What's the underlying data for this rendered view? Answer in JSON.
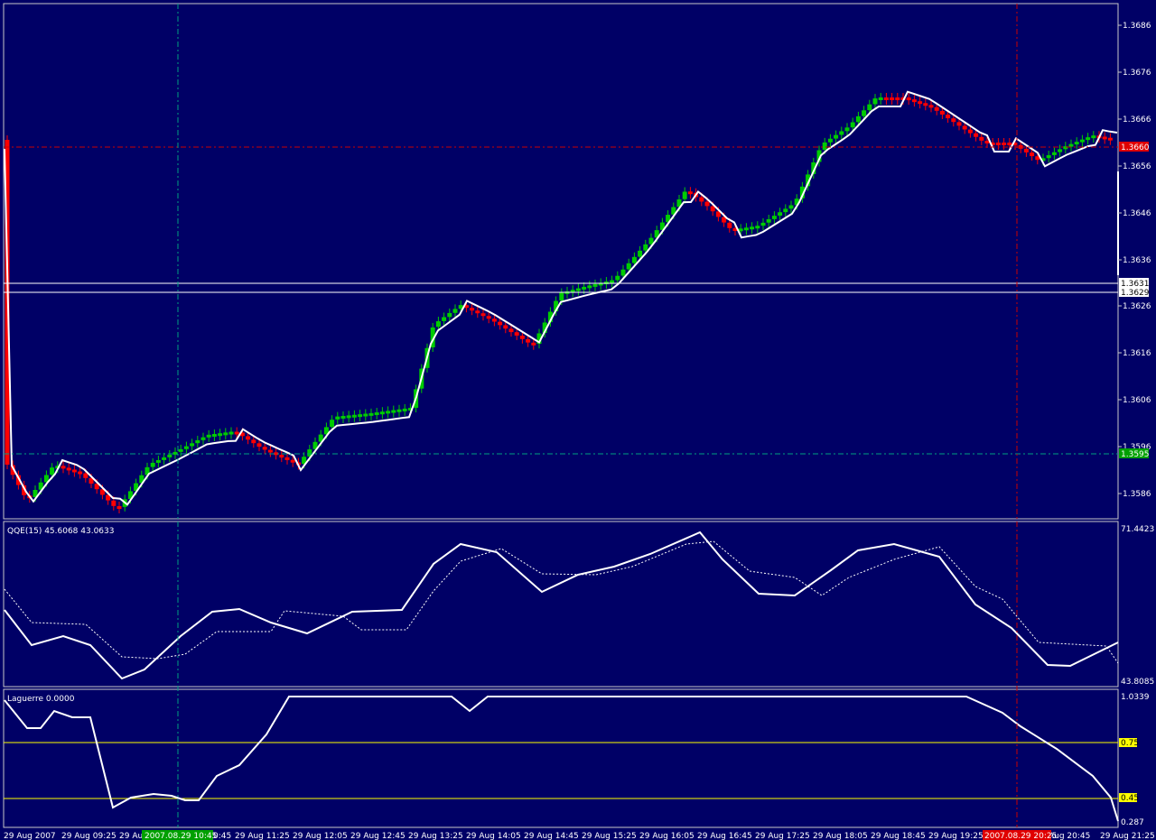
{
  "colors": {
    "background": "#000066",
    "frame": "#c8c8c8",
    "bull": "#00cc00",
    "bear": "#ff0000",
    "line": "#ffffff",
    "level": "#ffff00",
    "vline_green": "#00a080",
    "vline_red": "#cc0000",
    "hline_red": "#cc0000",
    "hline_green": "#00a080",
    "label_red_bg": "#e00000",
    "label_green_bg": "#00a000"
  },
  "price_panel": {
    "ticks": [
      "1.3686",
      "1.3676",
      "1.3666",
      "1.3656",
      "1.3646",
      "1.3636",
      "1.3626",
      "1.3616",
      "1.3606",
      "1.3596",
      "1.3586"
    ],
    "red_level": "1.3660",
    "green_level": "1.3595",
    "band_upper": "1.3631",
    "band_lower": "1.3629"
  },
  "qqe_panel": {
    "title": "QQE(15) 45.6068 43.0633",
    "top": "71.4423",
    "bottom": "43.8085"
  },
  "laguerre_panel": {
    "title": "Laguerre 0.0000",
    "top": "1.0339",
    "level_75": "0.75",
    "level_45": "0.45",
    "bottom": "0.287"
  },
  "time_axis": {
    "labels": [
      "29 Aug 2007",
      "29 Aug 09:25",
      "29 Au",
      "0:45",
      "29 Aug 11:25",
      "29 Aug 12:05",
      "29 Aug 12:45",
      "29 Aug 13:25",
      "29 Aug 14:05",
      "29 Aug 14:45",
      "29 Aug 15:25",
      "29 Aug 16:05",
      "29 Aug 16:45",
      "29 Aug 17:25",
      "29 Aug 18:05",
      "29 Aug 18:45",
      "29 Aug 19:25",
      "Aug 20:45",
      "29 Aug 21:25"
    ],
    "green_marker": "2007.08.29 10:45",
    "red_marker": "2007.08.29 20:25"
  },
  "chart_data": [
    {
      "type": "candlestick",
      "title": "",
      "timeframe_start": "29 Aug 2007",
      "ylim": [
        1.3581,
        1.369
      ],
      "ohlc": [],
      "envelope": []
    },
    {
      "type": "line",
      "title": "QQE(15) 45.6068 43.0633",
      "ylim": [
        43.8085,
        71.4423
      ],
      "series": [
        {
          "values": [
            52.0,
            50.0,
            47.5,
            45.6
          ]
        },
        {
          "values": [
            53.0,
            51.0,
            48.0,
            43.1
          ]
        }
      ]
    },
    {
      "type": "line",
      "title": "Laguerre 0.0000",
      "ylim": [
        0.287,
        1.0339
      ],
      "levels": [
        0.75,
        0.45
      ],
      "series": [
        {
          "values": [
            1.0,
            0.9,
            0.95,
            0.4,
            0.45,
            0.4,
            0.6,
            1.0,
            1.0,
            0.95,
            1.0,
            1.0,
            0.8,
            0.6,
            0.3
          ]
        }
      ]
    }
  ]
}
